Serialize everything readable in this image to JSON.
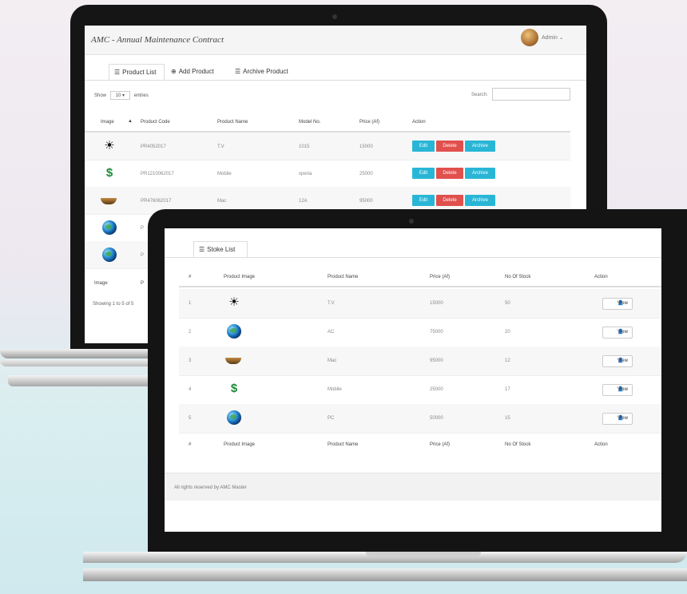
{
  "back_window": {
    "title": "AMC - Annual Maintenance Contract",
    "user": "Admin ⌄",
    "tabs": [
      {
        "icon": "list-icon",
        "glyph": "☰",
        "label": "Product List",
        "active": true
      },
      {
        "icon": "add-circle-icon",
        "glyph": "⊕",
        "label": "Add Product",
        "active": false
      },
      {
        "icon": "archive-icon",
        "glyph": "☰",
        "label": "Archive Product",
        "active": false
      }
    ],
    "show_label": "Show",
    "entries_value": "10",
    "entries_label": "entries",
    "search_label": "Search:",
    "columns": [
      "Image",
      "Product Code",
      "Product Name",
      "Model No.",
      "Price (Af)",
      "Action"
    ],
    "rows": [
      {
        "image": "tv-icon",
        "code": "PR4052017",
        "name": "T.V",
        "model": "1015",
        "price": "15000"
      },
      {
        "image": "mobile-icon",
        "code": "PR1210062017",
        "name": "Mobile",
        "model": "xperia",
        "price": "25000"
      },
      {
        "image": "mac-icon",
        "code": "PR476062017",
        "name": "Mac",
        "model": "12A",
        "price": "95000"
      },
      {
        "image": "globe-icon",
        "code": "P",
        "name": "",
        "model": "",
        "price": ""
      },
      {
        "image": "globe-icon",
        "code": "P",
        "name": "",
        "model": "",
        "price": ""
      }
    ],
    "actions": {
      "edit": "Edit",
      "delete": "Delete",
      "archive": "Archive"
    },
    "footer_col_image": "Image",
    "footer_col_code": "P",
    "showing": "Showing 1 to 5 of 5"
  },
  "front_window": {
    "tab": {
      "icon": "list-icon",
      "glyph": "☰",
      "label": "Stoke List"
    },
    "columns": [
      "#",
      "Product Image",
      "Product Name",
      "Price (Af)",
      "No Of Stock",
      "Action"
    ],
    "rows": [
      {
        "num": "1",
        "image": "tv-icon",
        "name": "T.V",
        "price": "15000",
        "stock": "50"
      },
      {
        "num": "2",
        "image": "globe-icon",
        "name": "AC",
        "price": "75000",
        "stock": "20"
      },
      {
        "num": "3",
        "image": "mac-icon",
        "name": "Mac",
        "price": "95000",
        "stock": "12"
      },
      {
        "num": "4",
        "image": "mobile-icon",
        "name": "Mobile",
        "price": "25000",
        "stock": "17"
      },
      {
        "num": "5",
        "image": "globe-icon",
        "name": "PC",
        "price": "50000",
        "stock": "15"
      }
    ],
    "view_label": "View",
    "view_glyph": "👤",
    "footer": "All rights reserved by AMC Master"
  }
}
